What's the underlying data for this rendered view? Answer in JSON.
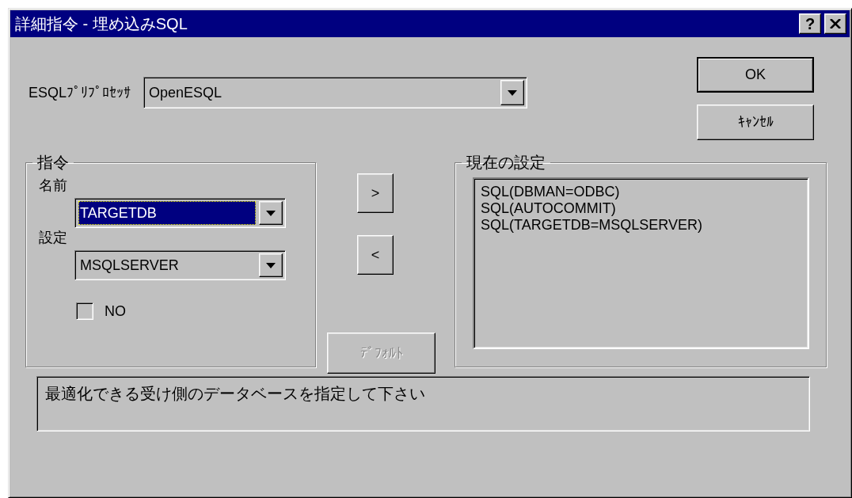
{
  "window": {
    "title": "詳細指令 - 埋め込みSQL",
    "title_buttons": [
      {
        "kind": "help",
        "label": "?"
      },
      {
        "kind": "close"
      }
    ]
  },
  "preprocessor": {
    "label": "ESQLﾌﾟﾘﾌﾟﾛｾｯｻ",
    "value": "OpenESQL",
    "focused": false
  },
  "buttons": [
    {
      "label": "OK",
      "default": true
    },
    {
      "label": "ｷｬﾝｾﾙ",
      "default": false
    }
  ],
  "directive": {
    "title": "指令",
    "name_label": "名前",
    "name": {
      "value": "TARGETDB",
      "focused": true
    },
    "setting_label": "設定",
    "setting": {
      "value": "MSQLSERVER",
      "focused": false
    },
    "checkbox": {
      "label": "NO",
      "checked": false
    }
  },
  "move_buttons": [
    {
      "label": ">"
    },
    {
      "label": "<"
    }
  ],
  "default_button": {
    "label": "ﾃﾞﾌｫﾙﾄ",
    "disabled": true
  },
  "current": {
    "title": "現在の設定",
    "items": [
      "SQL(DBMAN=ODBC)",
      "SQL(AUTOCOMMIT)",
      "SQL(TARGETDB=MSQLSERVER)"
    ]
  },
  "hint": "最適化できる受け側のデータベースを指定して下さい"
}
